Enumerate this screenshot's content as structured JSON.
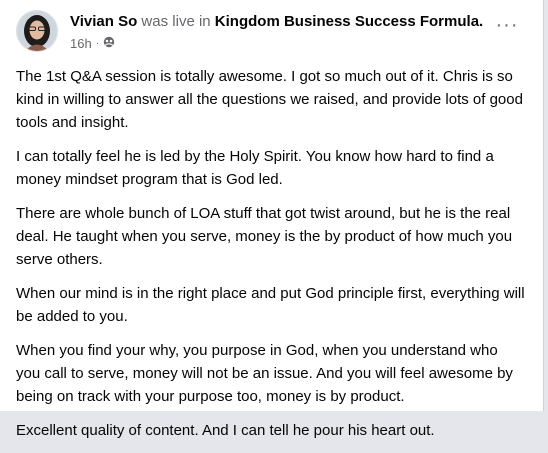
{
  "post": {
    "author": "Vivian So",
    "action_text": " was live in ",
    "group": "Kingdom Business Success Formula.",
    "time": "16h",
    "separator": "·",
    "privacy_icon": "group-audience-icon",
    "more_icon": "more-options-icon",
    "more_label": "···",
    "paragraphs": [
      "The 1st Q&A session is totally awesome. I got so much out of it. Chris  is so kind in willing to answer all the questions we raised, and provide lots of good tools and insight.",
      "I can totally feel he is led by the Holy Spirit. You know how hard to find a money mindset program that is God led.",
      "There are whole bunch of LOA stuff that got twist around, but he is the real deal. He taught when you serve, money is the by product of how much you serve others.",
      "When our mind is in the right place and put God principle first, everything will be added to you.",
      "When you find your why, you purpose in God, when you understand who you call to serve, money will not be an issue. And you will feel awesome by being on track with your purpose too, money is by product.",
      "Excellent quality of content. And I can tell he pour his heart out."
    ]
  },
  "colors": {
    "text": "#050505",
    "secondary": "#65676b",
    "card": "#ffffff",
    "background": "#e4e6eb"
  }
}
